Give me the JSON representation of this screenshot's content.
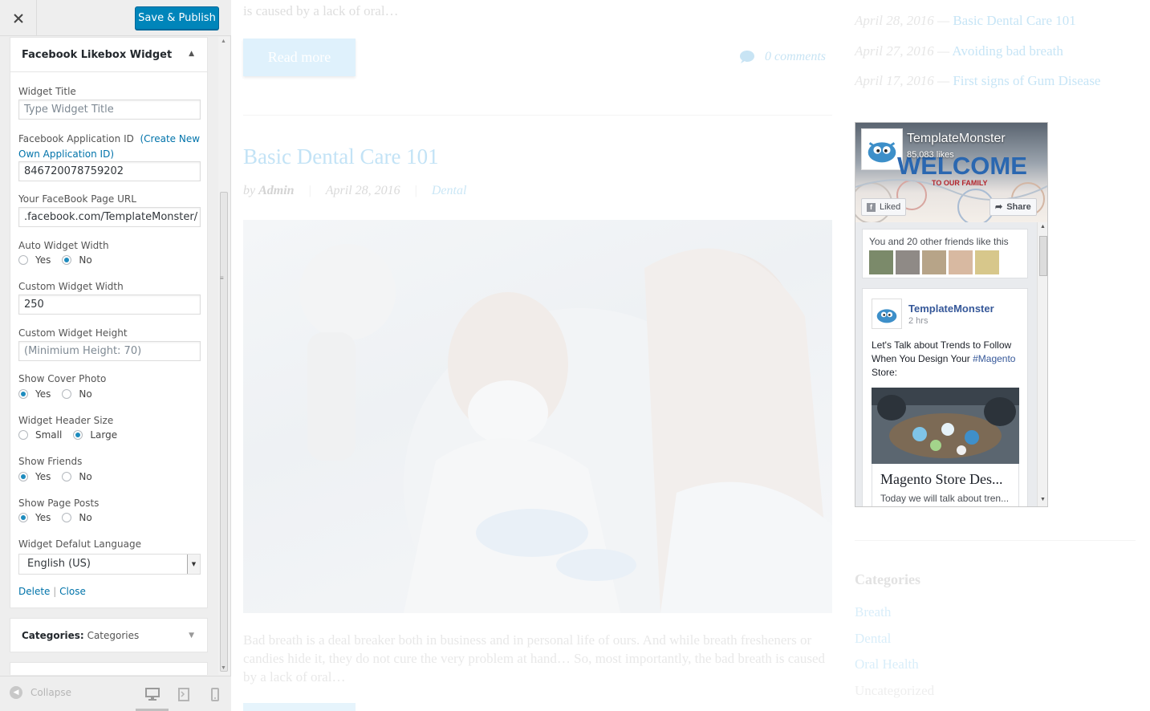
{
  "colors": {
    "accent": "#0085ba",
    "link": "#0073aa",
    "fb_blue": "#365899"
  },
  "header": {
    "save_label": "Save & Publish",
    "close_icon": "close-icon"
  },
  "widget": {
    "title": "Facebook Likebox Widget",
    "fields": {
      "widget_title_label": "Widget Title",
      "widget_title_placeholder": "Type Widget Title",
      "app_id_label": "Facebook Application ID",
      "app_id_link_open": "(",
      "app_id_link": "Create New Own Application ID",
      "app_id_link_close": ")",
      "app_id_value": "846720078759202",
      "page_url_label": "Your FaceBook Page URL",
      "page_url_value": ".facebook.com/TemplateMonster/",
      "auto_width_label": "Auto Widget Width",
      "custom_width_label": "Custom Widget Width",
      "custom_width_value": "250",
      "custom_height_label": "Custom Widget Height",
      "custom_height_placeholder": "(Minimium Height: 70)",
      "cover_label": "Show Cover Photo",
      "header_size_label": "Widget Header Size",
      "friends_label": "Show Friends",
      "posts_label": "Show Page Posts",
      "language_label": "Widget Defalut Language",
      "language_value": "English (US)"
    },
    "options": {
      "yes": "Yes",
      "no": "No",
      "small": "Small",
      "large": "Large"
    },
    "selected": {
      "auto_width": "No",
      "cover": "Yes",
      "header_size": "Large",
      "friends": "Yes",
      "posts": "Yes"
    },
    "delete_label": "Delete",
    "link_sep": "|",
    "close_label": "Close"
  },
  "categories_widget": {
    "label": "Categories:",
    "value": "Categories"
  },
  "footer": {
    "collapse_label": "Collapse"
  },
  "preview": {
    "excerpt_top": "is caused by a lack of oral…",
    "read_more": "Read more",
    "comments": "0 comments",
    "post_title": "Basic Dental Care 101",
    "meta_by": "by",
    "meta_author": "Admin",
    "meta_date": "April 28, 2016",
    "meta_category": "Dental",
    "excerpt": "Bad breath is a deal breaker both in business and in personal life of ours. And while breath fresheners or candies hide it, they do not cure the very problem at hand… So, most importantly, the bad breath is caused by a lack of oral…",
    "recent": [
      {
        "date": "April 28, 2016 —",
        "title": "Basic Dental Care 101"
      },
      {
        "date": "April 27, 2016 —",
        "title": "Avoiding bad breath"
      },
      {
        "date": "April 17, 2016 —",
        "title": "First signs of Gum Disease"
      }
    ],
    "categories_title": "Categories",
    "categories": [
      "Breath",
      "Dental",
      "Oral Health",
      "Uncategorized"
    ]
  },
  "facebook": {
    "page_name": "TemplateMonster",
    "likes": "85,083 likes",
    "welcome": "WELCOME",
    "family": "TO OUR FAMILY",
    "liked": "Liked",
    "share": "Share",
    "friends_text": "You and 20 other friends like this",
    "post_page": "TemplateMonster",
    "post_time": "2 hrs",
    "post_text": "Let's Talk about Trends to Follow When You Design Your",
    "post_tag": "#Magento",
    "post_text_end": "Store:",
    "link_title": "Magento Store Des...",
    "link_desc": "Today we will talk about tren..."
  }
}
